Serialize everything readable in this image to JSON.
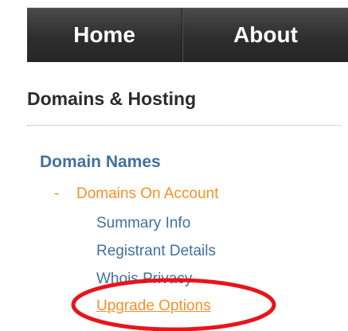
{
  "nav": {
    "tabs": [
      {
        "label": "Home"
      },
      {
        "label": "About"
      }
    ]
  },
  "menu": {
    "section_title": "Domains & Hosting",
    "group_title": "Domain Names",
    "active_item": {
      "prefix": "-",
      "label": "Domains On Account"
    },
    "sub_items": [
      {
        "label": "Summary Info"
      },
      {
        "label": "Registrant Details"
      },
      {
        "label": "Whois Privacy"
      },
      {
        "label": "Upgrade Options"
      }
    ]
  },
  "colors": {
    "nav_background": "#2e2e2e",
    "link_blue": "#41709e",
    "active_orange": "#f79026",
    "annotation_red": "#e8141c"
  }
}
